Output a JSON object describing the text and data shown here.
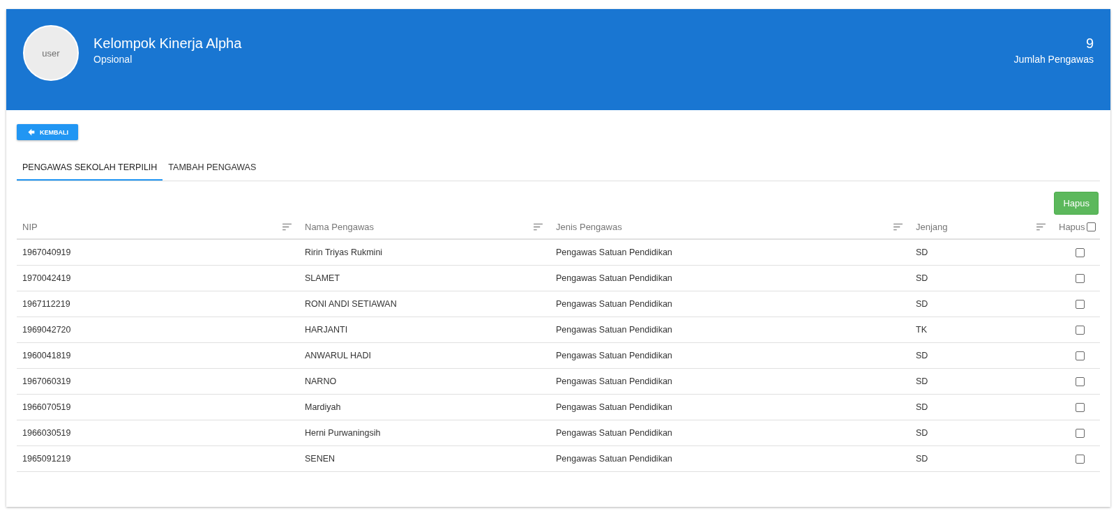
{
  "header": {
    "avatar_alt": "user",
    "title": "Kelompok Kinerja Alpha",
    "subtitle": "Opsional",
    "count": "9",
    "count_label": "Jumlah Pengawas"
  },
  "back_button": {
    "label": "KEMBALI"
  },
  "tabs": [
    {
      "label": "PENGAWAS SEKOLAH TERPILIH",
      "selected": true
    },
    {
      "label": "TAMBAH PENGAWAS",
      "selected": false
    }
  ],
  "delete_button": {
    "label": "Hapus"
  },
  "table": {
    "columns": [
      {
        "label": "NIP",
        "sortable": true
      },
      {
        "label": "Nama Pengawas",
        "sortable": true
      },
      {
        "label": "Jenis Pengawas",
        "sortable": true
      },
      {
        "label": "Jenjang",
        "sortable": true
      },
      {
        "label": "Hapus",
        "sortable": false
      }
    ],
    "select_all_checked": false,
    "rows": [
      {
        "nip": "1967040919",
        "nama": "Ririn Triyas Rukmini",
        "jenis": "Pengawas Satuan Pendidikan",
        "jenjang": "SD",
        "checked": false
      },
      {
        "nip": "1970042419",
        "nama": "SLAMET",
        "jenis": "Pengawas Satuan Pendidikan",
        "jenjang": "SD",
        "checked": false
      },
      {
        "nip": "1967112219",
        "nama": "RONI ANDI SETIAWAN",
        "jenis": "Pengawas Satuan Pendidikan",
        "jenjang": "SD",
        "checked": false
      },
      {
        "nip": "1969042720",
        "nama": "HARJANTI",
        "jenis": "Pengawas Satuan Pendidikan",
        "jenjang": "TK",
        "checked": false
      },
      {
        "nip": "1960041819",
        "nama": "ANWARUL HADI",
        "jenis": "Pengawas Satuan Pendidikan",
        "jenjang": "SD",
        "checked": false
      },
      {
        "nip": "1967060319",
        "nama": "NARNO",
        "jenis": "Pengawas Satuan Pendidikan",
        "jenjang": "SD",
        "checked": false
      },
      {
        "nip": "1966070519",
        "nama": "Mardiyah",
        "jenis": "Pengawas Satuan Pendidikan",
        "jenjang": "SD",
        "checked": false
      },
      {
        "nip": "1966030519",
        "nama": "Herni Purwaningsih",
        "jenis": "Pengawas Satuan Pendidikan",
        "jenjang": "SD",
        "checked": false
      },
      {
        "nip": "1965091219",
        "nama": "SENEN",
        "jenis": "Pengawas Satuan Pendidikan",
        "jenjang": "SD",
        "checked": false
      }
    ]
  }
}
